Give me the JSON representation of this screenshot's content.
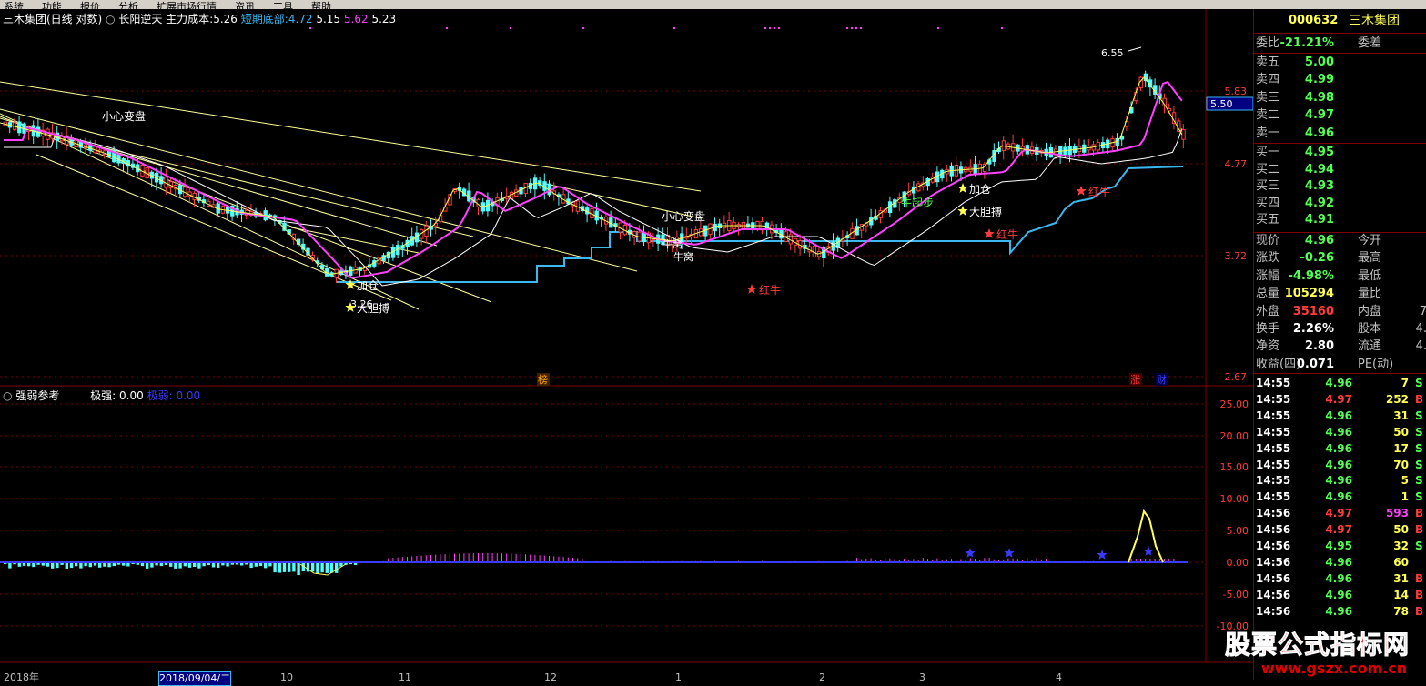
{
  "menu": [
    "系统",
    "功能",
    "报价",
    "分析",
    "扩展市场行情",
    "资讯",
    "工具",
    "帮助"
  ],
  "main_panel": {
    "title": "三木集团(日线 对数)",
    "indicator_name": "长阳逆天",
    "cost_label": "主力成本:",
    "cost_value": "5.26",
    "bottom_label": "短期底部:",
    "bottom_v1": "4.72",
    "bottom_v2": "5.15",
    "bottom_v3": "5.62",
    "bottom_v4": "5.23",
    "price_ticks": [
      "5.83",
      "4.77",
      "3.72",
      "2.67"
    ],
    "current_price_tag": "5.50",
    "annotations": {
      "caution1": "小心变盘",
      "caution2": "小心变盘",
      "high_label": "6.55",
      "low_label": "3.26",
      "add1": "加仓",
      "bold1": "大胆搏",
      "add2": "加仓",
      "bold2": "大胆搏",
      "start": "牛起步",
      "nest1": "牛窝",
      "nest2": "牛窝",
      "red1": "红牛",
      "red2": "红牛",
      "red3": "红牛",
      "bang": "榜",
      "zhang": "涨",
      "cai": "财"
    }
  },
  "sub_panel": {
    "title": "强弱参考",
    "strong_label": "极强:",
    "strong_value": "0.00",
    "weak_label": "极弱:",
    "weak_value": "0.00",
    "ticks": [
      "25.00",
      "20.00",
      "15.00",
      "10.00",
      "5.00",
      "0.00",
      "-5.00",
      "-10.00"
    ]
  },
  "x_axis": [
    "2018年",
    "2018/09/04/二",
    "10",
    "11",
    "12",
    "1",
    "2",
    "3",
    "4"
  ],
  "quote": {
    "code": "000632",
    "name": "三木集团",
    "weibi_label": "委比",
    "weibi_value": "-21.21%",
    "weicha_label": "委差",
    "asks": [
      {
        "label": "卖五",
        "price": "5.00"
      },
      {
        "label": "卖四",
        "price": "4.99"
      },
      {
        "label": "卖三",
        "price": "4.98"
      },
      {
        "label": "卖二",
        "price": "4.97"
      },
      {
        "label": "卖一",
        "price": "4.96"
      }
    ],
    "bids": [
      {
        "label": "买一",
        "price": "4.95"
      },
      {
        "label": "买二",
        "price": "4.94"
      },
      {
        "label": "买三",
        "price": "4.93"
      },
      {
        "label": "买四",
        "price": "4.92"
      },
      {
        "label": "买五",
        "price": "4.91"
      }
    ],
    "stats": [
      {
        "l1": "现价",
        "v1": "4.96",
        "l2": "今开",
        "v2": ""
      },
      {
        "l1": "涨跌",
        "v1": "-0.26",
        "l2": "最高",
        "v2": ""
      },
      {
        "l1": "涨幅",
        "v1": "-4.98%",
        "l2": "最低",
        "v2": ""
      },
      {
        "l1": "总量",
        "v1": "105294",
        "l2": "量比",
        "v2": ""
      },
      {
        "l1": "外盘",
        "v1": "35160",
        "l2": "内盘",
        "v2": "7"
      },
      {
        "l1": "换手",
        "v1": "2.26%",
        "l2": "股本",
        "v2": "4."
      },
      {
        "l1": "净资",
        "v1": "2.80",
        "l2": "流通",
        "v2": "4."
      },
      {
        "l1": "收益(四)",
        "v1": "0.071",
        "l2": "PE(动)",
        "v2": ""
      }
    ],
    "ticks": [
      {
        "time": "14:55",
        "price": "4.96",
        "vol": "7",
        "side": "S"
      },
      {
        "time": "14:55",
        "price": "4.97",
        "vol": "252",
        "side": "B"
      },
      {
        "time": "14:55",
        "price": "4.96",
        "vol": "31",
        "side": "S"
      },
      {
        "time": "14:55",
        "price": "4.96",
        "vol": "50",
        "side": "S"
      },
      {
        "time": "14:55",
        "price": "4.96",
        "vol": "17",
        "side": "S"
      },
      {
        "time": "14:55",
        "price": "4.96",
        "vol": "70",
        "side": "S"
      },
      {
        "time": "14:55",
        "price": "4.96",
        "vol": "5",
        "side": "S"
      },
      {
        "time": "14:55",
        "price": "4.96",
        "vol": "1",
        "side": "S"
      },
      {
        "time": "14:56",
        "price": "4.97",
        "vol": "593",
        "side": "B"
      },
      {
        "time": "14:56",
        "price": "4.97",
        "vol": "50",
        "side": "B"
      },
      {
        "time": "14:56",
        "price": "4.95",
        "vol": "32",
        "side": "S"
      },
      {
        "time": "14:56",
        "price": "4.96",
        "vol": "60",
        "side": ""
      },
      {
        "time": "14:56",
        "price": "4.96",
        "vol": "31",
        "side": "B"
      },
      {
        "time": "14:56",
        "price": "4.96",
        "vol": "14",
        "side": "B"
      },
      {
        "time": "14:56",
        "price": "4.96",
        "vol": "78",
        "side": "B"
      }
    ]
  },
  "watermark": {
    "title": "股票公式指标网",
    "url": "www.gszx.com.cn"
  },
  "colors": {
    "up": "#ff3c3c",
    "down": "#54fcfc",
    "ma_magenta": "#ff40ff",
    "ma_yellow": "#ffff54",
    "ma_white": "#ffffff",
    "support": "#3ab8f0",
    "grid": "#800000"
  }
}
